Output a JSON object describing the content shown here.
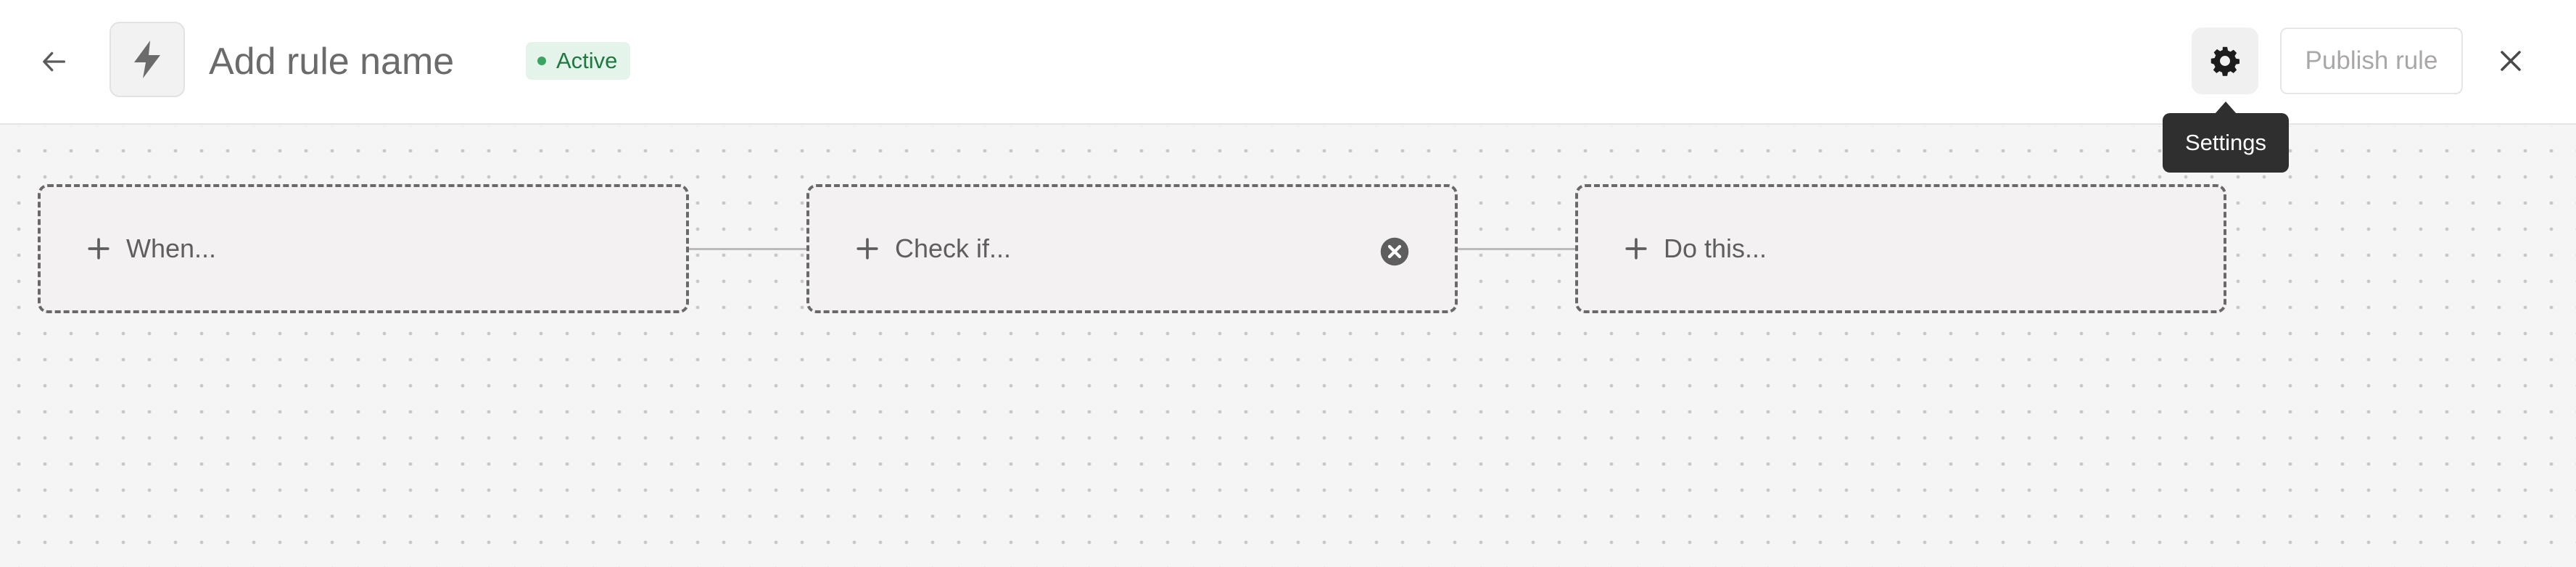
{
  "header": {
    "back_icon": "arrow-left-icon",
    "rule_icon": "lightning-bolt-icon",
    "rule_name_placeholder": "Add rule name",
    "status_label": "Active",
    "status_color": "#1d7a3f",
    "settings_icon": "gear-icon",
    "publish_label": "Publish rule",
    "close_icon": "close-icon"
  },
  "tooltip": {
    "label": "Settings"
  },
  "flow": {
    "steps": [
      {
        "label": "When...",
        "icon": "plus-icon"
      },
      {
        "label": "Check if...",
        "icon": "plus-icon",
        "remove_icon": "circle-x-icon"
      },
      {
        "label": "Do this...",
        "icon": "plus-icon"
      }
    ]
  }
}
